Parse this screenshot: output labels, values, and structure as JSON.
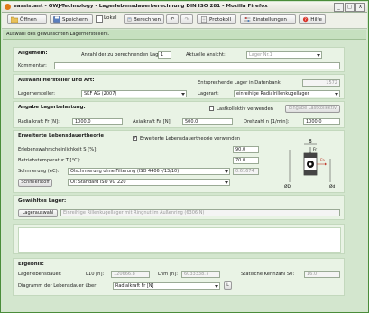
{
  "window": {
    "title": "eassistant - GWJ-Technology - Lagerlebensdauerberechnung DIN ISO 281 - Mozilla Firefox",
    "min": "_",
    "max": "□",
    "close": "X"
  },
  "toolbar": {
    "open": "Öffnen",
    "save": "Speichern",
    "local": "Lokal",
    "calculate": "Berechnen",
    "protocol": "Protokoll",
    "settings": "Einstellungen",
    "help": "Hilfe"
  },
  "banner": "Auswahl des gewünschten Lagerherstellers.",
  "allgemein": {
    "heading": "Allgemein:",
    "count_label": "Anzahl der zu berechnenden Lager:",
    "count_value": "1",
    "view_label": "Aktuelle Ansicht:",
    "view_value": "Lager Nr.1",
    "comment_label": "Kommentar:",
    "comment_value": ""
  },
  "hersteller": {
    "heading": "Auswahl Hersteller und Art:",
    "db_label": "Entsprechende Lager in Datenbank:",
    "db_value": "1572",
    "maker_label": "Lagerhersteller:",
    "maker_value": "SKF AG (2007)",
    "type_label": "Lagerart:",
    "type_value": "einreihige Radialrillenkugellager"
  },
  "belastung": {
    "heading": "Angabe Lagerbelastung:",
    "cycle_label": "Lastkollektiv verwenden",
    "cycle_button": "Eingabe Lastkollektiv",
    "radial_label": "Radialkraft Fr [N]:",
    "radial_value": "1000.0",
    "axial_label": "Axialkraft Fa [N]:",
    "axial_value": "500.0",
    "speed_label": "Drehzahl n [1/min]:",
    "speed_value": "1000.0"
  },
  "erweitert": {
    "heading": "Erweiterte Lebensdauertheorie",
    "use_label": "Erweiterte Lebensdauertheorie verwenden",
    "prob_label": "Erlebenswahrscheinlichkeit S [%]:",
    "prob_value": "90.0",
    "temp_label": "Betriebstemperatur T [°C]:",
    "temp_value": "70.0",
    "lube_label": "Schmierung (eC):",
    "lube_value": "Ölschmierung ohne Filterung (ISO 4406 -/13/10)",
    "lube_factor": "0.61674",
    "grease_button": "Schmierstoff",
    "grease_value": "Öl: Standard ISO VG 220"
  },
  "diagram": {
    "b": "B",
    "fr": "Fr",
    "fa": "Fa",
    "d_outer": "ØD",
    "d_inner": "Ød"
  },
  "gewaehlt": {
    "heading": "Gewähltes Lager:",
    "button": "Lagerauswahl",
    "value": "Einreihige Rillenkugellager mit Ringnut im Außenring (6306 N)"
  },
  "ergebnis": {
    "heading": "Ergebnis:",
    "life_label": "Lagerlebensdauer:",
    "l10_label": "L10 [h]:",
    "l10_value": "120666.8",
    "lnm_label": "Lnm [h]:",
    "lnm_value": "6033338.7",
    "s0_label": "Statische Kennzahl S0:",
    "s0_value": "16.0",
    "chart_label": "Diagramm der Lebensdauer über",
    "chart_value": "Radialkraft Fr [N]",
    "chart_button": "L"
  },
  "colors": {
    "frame": "#d3e6ce",
    "panel": "#e9f3e5",
    "banner": "#c6e0bf",
    "accent": "#4a8c3a"
  }
}
